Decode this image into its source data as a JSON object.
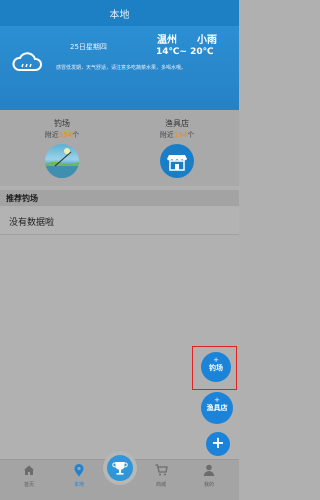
{
  "header": {
    "title": "本地"
  },
  "weather": {
    "date": "25日星期四",
    "city": "温州",
    "condition": "小雨",
    "temperature": "14℃~ 20℃",
    "tip": "感冒低发期，天气舒适，请注意多吃蔬菜水果，多喝水哦。",
    "icon": "cloud-rain-icon"
  },
  "stats": {
    "spots": {
      "label": "钓场",
      "prefix": "附近",
      "count": "154",
      "suffix": "个"
    },
    "shops": {
      "label": "渔具店",
      "prefix": "附近",
      "count": "194",
      "suffix": "个"
    }
  },
  "recommend": {
    "heading": "推荐钓场",
    "empty_text": "没有数据啦"
  },
  "fabs": {
    "spot": {
      "plus": "+",
      "label": "钓场"
    },
    "tackle": {
      "plus": "+",
      "label": "渔具店"
    },
    "add": {
      "label": "+"
    }
  },
  "tabs": [
    {
      "label": "首页",
      "icon": "home-icon"
    },
    {
      "label": "本地",
      "icon": "location-pin-icon"
    },
    {
      "label": "",
      "icon": "trophy-icon"
    },
    {
      "label": "商城",
      "icon": "cart-icon"
    },
    {
      "label": "我的",
      "icon": "person-icon"
    }
  ],
  "colors": {
    "accent": "#1c84d8",
    "highlight_border": "#e02424",
    "count_orange": "#ef8a16"
  }
}
